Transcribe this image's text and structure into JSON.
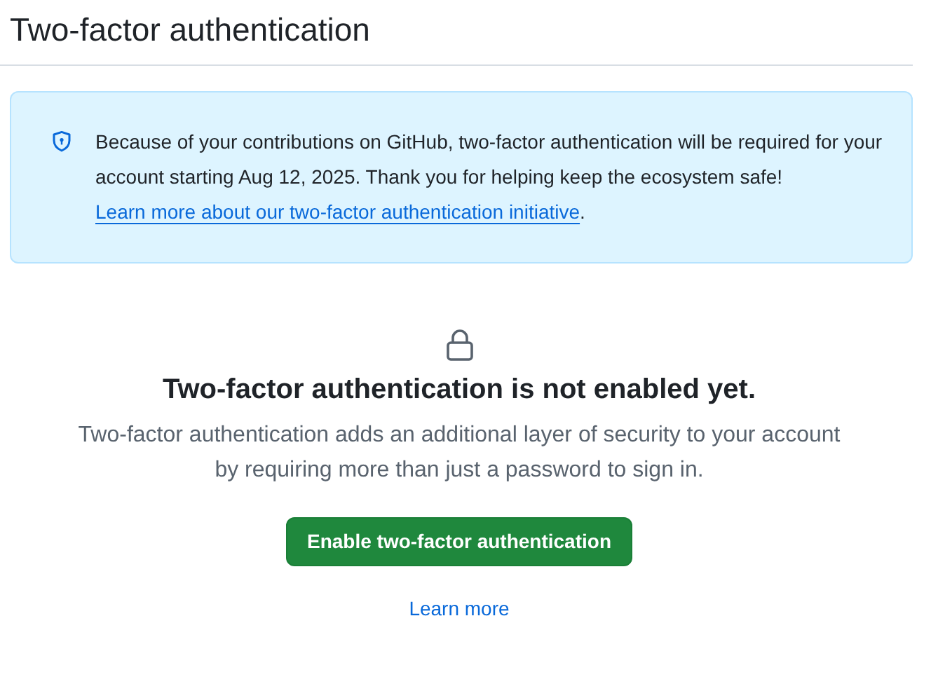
{
  "page_title": "Two-factor authentication",
  "notice": {
    "text": "Because of your contributions on GitHub, two-factor authentication will be required for your account starting Aug 12, 2025. Thank you for helping keep the ecosystem safe! ",
    "link": "Learn more about our two-factor authentication initiative",
    "text_after": "."
  },
  "empty_state": {
    "heading": "Two-factor authentication is not enabled yet.",
    "description": "Two-factor authentication adds an additional layer of security to your account by requiring more than just a password to sign in.",
    "button": "Enable two-factor authentication",
    "link": "Learn more"
  }
}
